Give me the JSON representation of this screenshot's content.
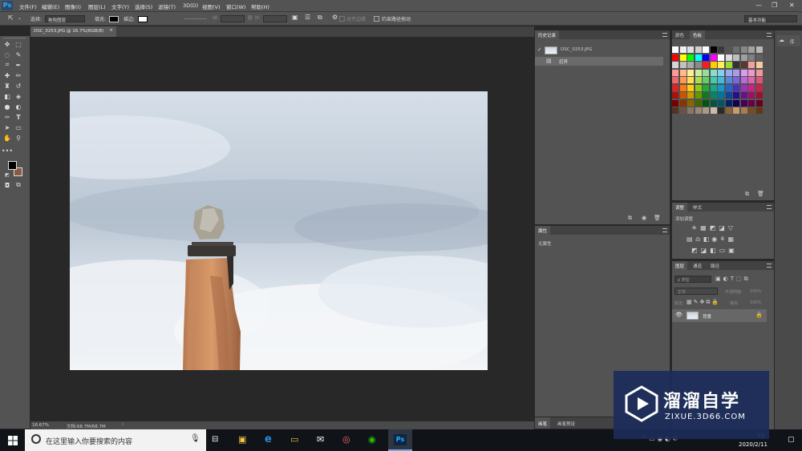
{
  "app": {
    "logo": "Ps"
  },
  "menu": [
    "文件(F)",
    "编辑(E)",
    "图像(I)",
    "图层(L)",
    "文字(Y)",
    "选择(S)",
    "滤镜(T)",
    "3D(D)",
    "视图(V)",
    "窗口(W)",
    "帮助(H)"
  ],
  "options": {
    "select_label": "选择:",
    "select_value": "拖阻图层",
    "fill_label": "填充:",
    "stroke_label": "描边:",
    "w_label": "W:",
    "h_label": "H:",
    "align_edges": "对齐边缘",
    "constrain_path": "约束路径拖动",
    "workspace": "基本功能"
  },
  "document": {
    "tab_title": "DSC_0253.JPG @ 16.7%(RGB/8)",
    "close": "×",
    "zoom": "16.67%",
    "doc_size": "文档:68.7M/68.7M"
  },
  "panels": {
    "history": {
      "tab": "历史记录",
      "snapshot_name": "DSC_0253.JPG",
      "steps": [
        "打开"
      ]
    },
    "properties": {
      "tab": "属性",
      "empty_text": "无属性"
    },
    "bottom_tabs": [
      "画笔",
      "画笔预设"
    ],
    "color_tabs": [
      "颜色",
      "色板"
    ],
    "adjustments": {
      "tabs": [
        "调整",
        "样式"
      ],
      "add_label": "添加调整"
    },
    "layers": {
      "tabs": [
        "图层",
        "通道",
        "路径"
      ],
      "kind_placeholder": "ρ 类型",
      "blend_mode": "正常",
      "opacity_label": "不透明度:",
      "opacity_value": "100%",
      "lock_label": "锁定:",
      "fill_label": "填充:",
      "fill_value": "100%",
      "layer_name": "背景"
    },
    "libraries": {
      "tab": "库"
    }
  },
  "swatch_colors": [
    [
      "#ffffff",
      "#f0f0f0",
      "#e0e0e0",
      "#cfcfcf",
      "#ffffff",
      "#000000",
      "#3a3a3a",
      "#555555",
      "#6e6e6e",
      "#888888",
      "#a0a0a0",
      "#b8b8b8"
    ],
    [
      "#ff0000",
      "#ffff00",
      "#00ff00",
      "#00ffff",
      "#0000ff",
      "#ff00ff",
      "#ffffff",
      "#dcdcdc",
      "#bfbfbf",
      "#9f9f9f",
      "#808080",
      "#606060"
    ],
    [
      "#d4d4d4",
      "#c0c0c0",
      "#a9a9a9",
      "#8a8a8a",
      "#ff1a1a",
      "#ffcc00",
      "#ffee55",
      "#99dd33",
      "#333333",
      "#5a3a2a",
      "#f5a0a0",
      "#f8c8a0"
    ],
    [
      "#ff9999",
      "#ffbb88",
      "#ffee99",
      "#ccee99",
      "#99dd99",
      "#88ddcc",
      "#88ccee",
      "#99aaee",
      "#aa99ee",
      "#dd99ee",
      "#ee99cc",
      "#ee9999"
    ],
    [
      "#ee6666",
      "#ff9955",
      "#ffdd55",
      "#aadd55",
      "#66cc66",
      "#44ccaa",
      "#44bbdd",
      "#5588dd",
      "#7766dd",
      "#bb66dd",
      "#dd66aa",
      "#dd5577"
    ],
    [
      "#dd2222",
      "#ff7711",
      "#ffcc11",
      "#88cc11",
      "#22aa33",
      "#11aa88",
      "#1199cc",
      "#2266cc",
      "#4433bb",
      "#9933bb",
      "#cc2288",
      "#cc2244"
    ],
    [
      "#aa1111",
      "#cc5500",
      "#cc9900",
      "#669900",
      "#117722",
      "#008866",
      "#007799",
      "#114499",
      "#221188",
      "#661188",
      "#991166",
      "#991133"
    ],
    [
      "#770000",
      "#883300",
      "#886600",
      "#446600",
      "#005511",
      "#005544",
      "#005566",
      "#002266",
      "#110055",
      "#440055",
      "#660044",
      "#660022"
    ],
    [
      "#553322",
      "#665544",
      "#887766",
      "#998877",
      "#aa9988",
      "#ccbbaa",
      "#2b2b2b",
      "#8c6239",
      "#c69c6d",
      "#a67c52",
      "#754c24",
      "#603913"
    ]
  ],
  "taskbar": {
    "search_placeholder": "在这里输入你要搜索的内容",
    "app_ps": "Ps",
    "time": "23",
    "date": "2020/2/11"
  },
  "watermark": {
    "title": "溜溜自学",
    "url": "ZIXUE.3D66.COM"
  },
  "colors": {
    "chrome": "#535353",
    "panel_header": "#424242",
    "canvas_bg": "#282828",
    "accent_ps": "#31a8ff",
    "foreground": "#000000",
    "background": "#8a5a45"
  }
}
